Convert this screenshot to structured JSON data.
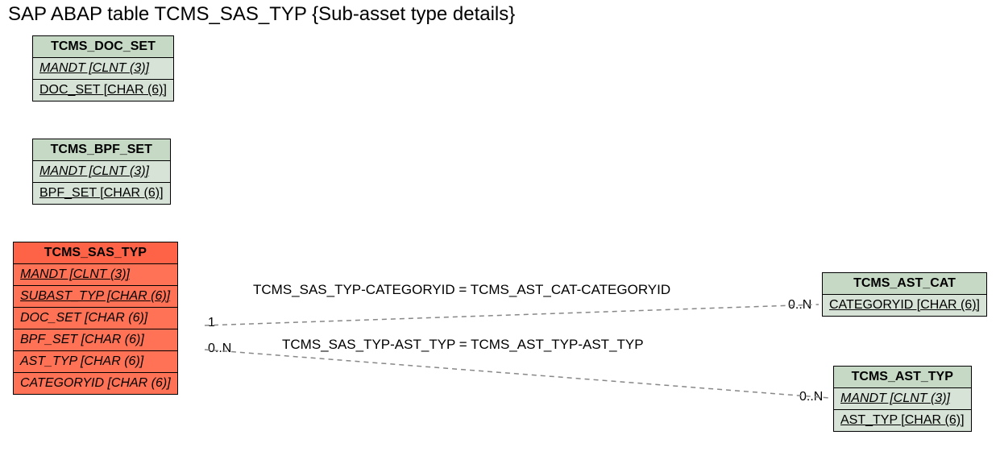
{
  "title": "SAP ABAP table TCMS_SAS_TYP {Sub-asset type details}",
  "tables": {
    "doc_set": {
      "name": "TCMS_DOC_SET",
      "rows": [
        "MANDT [CLNT (3)]",
        "DOC_SET [CHAR (6)]"
      ]
    },
    "bpf_set": {
      "name": "TCMS_BPF_SET",
      "rows": [
        "MANDT [CLNT (3)]",
        "BPF_SET [CHAR (6)]"
      ]
    },
    "sas_typ": {
      "name": "TCMS_SAS_TYP",
      "rows": [
        "MANDT [CLNT (3)]",
        "SUBAST_TYP [CHAR (6)]",
        "DOC_SET [CHAR (6)]",
        "BPF_SET [CHAR (6)]",
        "AST_TYP [CHAR (6)]",
        "CATEGORYID [CHAR (6)]"
      ]
    },
    "ast_cat": {
      "name": "TCMS_AST_CAT",
      "rows": [
        "CATEGORYID [CHAR (6)]"
      ]
    },
    "ast_typ": {
      "name": "TCMS_AST_TYP",
      "rows": [
        "MANDT [CLNT (3)]",
        "AST_TYP [CHAR (6)]"
      ]
    }
  },
  "relations": {
    "r1": "TCMS_SAS_TYP-CATEGORYID = TCMS_AST_CAT-CATEGORYID",
    "r2": "TCMS_SAS_TYP-AST_TYP = TCMS_AST_TYP-AST_TYP"
  },
  "cardinalities": {
    "c1": "1",
    "c2": "0..N",
    "c3": "0..N",
    "c4": "0..N"
  }
}
